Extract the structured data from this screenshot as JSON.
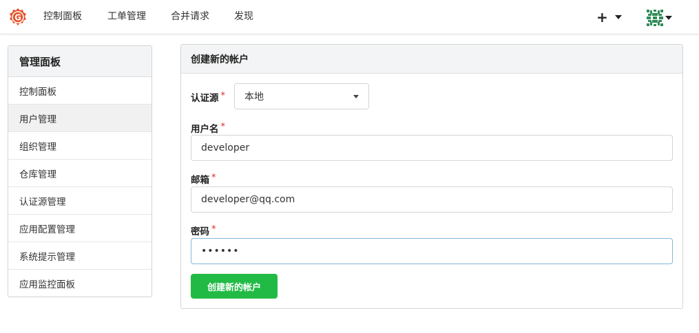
{
  "navbar": {
    "logo_icon": "gitea-logo-icon",
    "items": [
      {
        "label": "控制面板"
      },
      {
        "label": "工单管理"
      },
      {
        "label": "合并请求"
      },
      {
        "label": "发现"
      }
    ],
    "create_menu_icon": "plus-icon",
    "user_avatar_icon": "identicon-avatar-icon"
  },
  "sidebar": {
    "title": "管理面板",
    "items": [
      {
        "label": "控制面板",
        "active": false
      },
      {
        "label": "用户管理",
        "active": true
      },
      {
        "label": "组织管理",
        "active": false
      },
      {
        "label": "仓库管理",
        "active": false
      },
      {
        "label": "认证源管理",
        "active": false
      },
      {
        "label": "应用配置管理",
        "active": false
      },
      {
        "label": "系统提示管理",
        "active": false
      },
      {
        "label": "应用监控面板",
        "active": false
      }
    ]
  },
  "form": {
    "title": "创建新的帐户",
    "auth_source": {
      "label": "认证源",
      "required_mark": "*",
      "value": "本地"
    },
    "username": {
      "label": "用户名",
      "required_mark": "*",
      "value": "developer"
    },
    "email": {
      "label": "邮箱",
      "required_mark": "*",
      "value": "developer@qq.com"
    },
    "password": {
      "label": "密码",
      "required_mark": "*",
      "value": "••••••"
    },
    "submit_label": "创建新的帐户"
  },
  "colors": {
    "primary_green": "#21ba45",
    "required_red": "#db2828",
    "logo_orange": "#e5532d",
    "avatar_green": "#2e8b57",
    "focus_border": "#85b7d9"
  }
}
